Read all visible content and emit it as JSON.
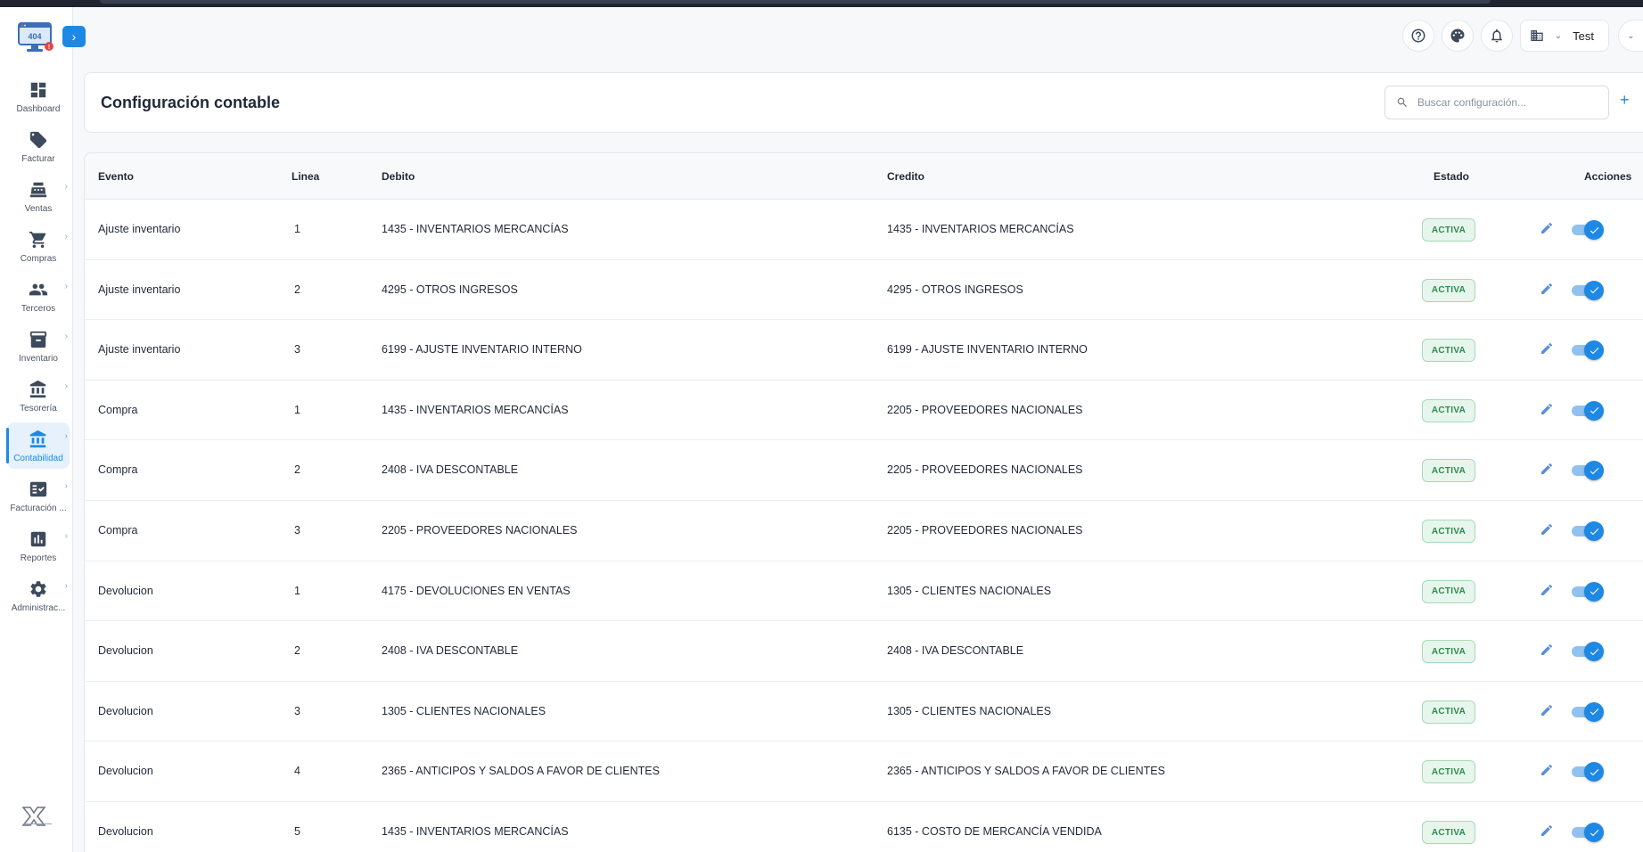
{
  "sidebar": {
    "items": [
      {
        "label": "Dashboard",
        "icon": "dashboard-icon",
        "chevron": false,
        "active": false
      },
      {
        "label": "Facturar",
        "icon": "tag-icon",
        "chevron": false,
        "active": false
      },
      {
        "label": "Ventas",
        "icon": "cash-register-icon",
        "chevron": true,
        "active": false
      },
      {
        "label": "Compras",
        "icon": "cart-icon",
        "chevron": true,
        "active": false
      },
      {
        "label": "Terceros",
        "icon": "people-icon",
        "chevron": true,
        "active": false
      },
      {
        "label": "Inventario",
        "icon": "archive-icon",
        "chevron": true,
        "active": false
      },
      {
        "label": "Tesorería",
        "icon": "bank-icon",
        "chevron": true,
        "active": false
      },
      {
        "label": "Contabilidad",
        "icon": "bank-icon",
        "chevron": true,
        "active": true
      },
      {
        "label": "Facturación ...",
        "icon": "fact-check-icon",
        "chevron": true,
        "active": false
      },
      {
        "label": "Reportes",
        "icon": "chart-icon",
        "chevron": true,
        "active": false
      },
      {
        "label": "Administrac...",
        "icon": "gear-icon",
        "chevron": true,
        "active": false
      }
    ],
    "logo_text": "404",
    "expand_icon": "›",
    "chevron_glyph": "›"
  },
  "header": {
    "org_name": "Test",
    "caret": "⌄"
  },
  "page": {
    "title": "Configuración contable",
    "search_placeholder": "Buscar configuración...",
    "add_glyph": "+"
  },
  "table": {
    "columns": {
      "evento": "Evento",
      "linea": "Linea",
      "debito": "Debito",
      "credito": "Credito",
      "estado": "Estado",
      "acciones": "Acciones"
    },
    "rows": [
      {
        "evento": "Ajuste inventario",
        "linea": "1",
        "debito": "1435 - INVENTARIOS MERCANCÍAS",
        "credito": "1435 - INVENTARIOS MERCANCÍAS",
        "estado": "ACTIVA"
      },
      {
        "evento": "Ajuste inventario",
        "linea": "2",
        "debito": "4295 - OTROS INGRESOS",
        "credito": "4295 - OTROS INGRESOS",
        "estado": "ACTIVA"
      },
      {
        "evento": "Ajuste inventario",
        "linea": "3",
        "debito": "6199 - AJUSTE INVENTARIO INTERNO",
        "credito": "6199 - AJUSTE INVENTARIO INTERNO",
        "estado": "ACTIVA"
      },
      {
        "evento": "Compra",
        "linea": "1",
        "debito": "1435 - INVENTARIOS MERCANCÍAS",
        "credito": "2205 - PROVEEDORES NACIONALES",
        "estado": "ACTIVA"
      },
      {
        "evento": "Compra",
        "linea": "2",
        "debito": "2408 - IVA DESCONTABLE",
        "credito": "2205 - PROVEEDORES NACIONALES",
        "estado": "ACTIVA"
      },
      {
        "evento": "Compra",
        "linea": "3",
        "debito": "2205 - PROVEEDORES NACIONALES",
        "credito": "2205 - PROVEEDORES NACIONALES",
        "estado": "ACTIVA"
      },
      {
        "evento": "Devolucion",
        "linea": "1",
        "debito": "4175 - DEVOLUCIONES EN VENTAS",
        "credito": "1305 - CLIENTES NACIONALES",
        "estado": "ACTIVA"
      },
      {
        "evento": "Devolucion",
        "linea": "2",
        "debito": "2408 - IVA DESCONTABLE",
        "credito": "2408 - IVA DESCONTABLE",
        "estado": "ACTIVA"
      },
      {
        "evento": "Devolucion",
        "linea": "3",
        "debito": "1305 - CLIENTES NACIONALES",
        "credito": "1305 - CLIENTES NACIONALES",
        "estado": "ACTIVA"
      },
      {
        "evento": "Devolucion",
        "linea": "4",
        "debito": "2365 - ANTICIPOS Y SALDOS A FAVOR DE CLIENTES",
        "credito": "2365 - ANTICIPOS Y SALDOS A FAVOR DE CLIENTES",
        "estado": "ACTIVA"
      },
      {
        "evento": "Devolucion",
        "linea": "5",
        "debito": "1435 - INVENTARIOS MERCANCÍAS",
        "credito": "6135 - COSTO DE MERCANCÍA VENDIDA",
        "estado": "ACTIVA"
      }
    ]
  },
  "colors": {
    "accent": "#1e88e5",
    "badge_bg": "#e7f6ec",
    "badge_text": "#2e8b4f",
    "badge_border": "#a8d9b5",
    "toggle_track": "#90c2ef"
  }
}
